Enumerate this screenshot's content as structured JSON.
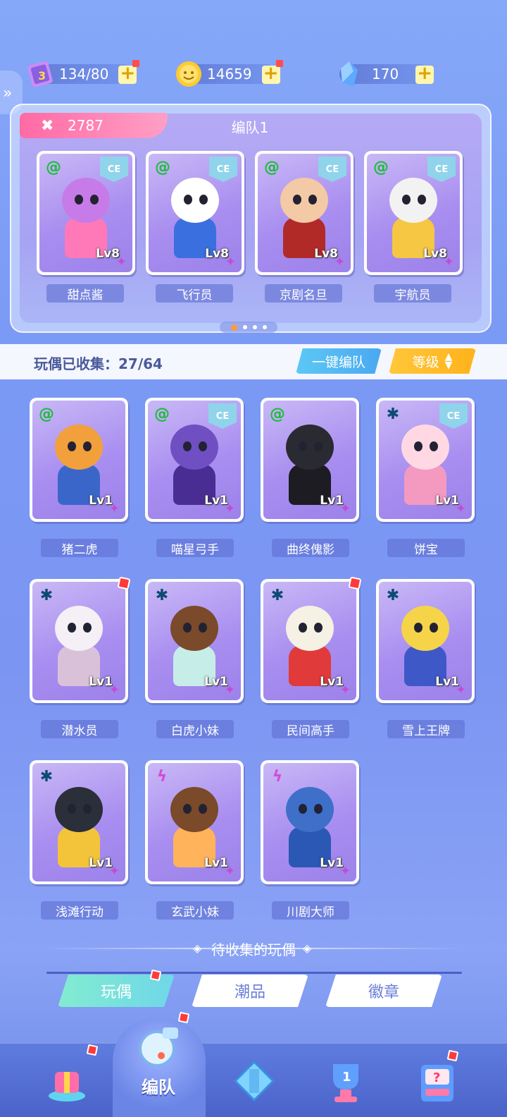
{
  "resources": {
    "stamina": {
      "value": "134/80",
      "icon": "ticket-icon"
    },
    "coins": {
      "value": "14659",
      "icon": "coin-icon"
    },
    "gems": {
      "value": "170",
      "icon": "crystal-icon"
    }
  },
  "team": {
    "power": "2787",
    "title": "编队1",
    "members": [
      {
        "name": "甜点酱",
        "level": "Lv8",
        "type": "spiral",
        "ce": "CE",
        "head": "#c77be8",
        "body": "#ff79b9"
      },
      {
        "name": "飞行员",
        "level": "Lv8",
        "type": "spiral",
        "ce": "CE",
        "head": "#ffffff",
        "body": "#3a6fe0"
      },
      {
        "name": "京剧名旦",
        "level": "Lv8",
        "type": "spiral",
        "ce": "CE",
        "head": "#f4c9a5",
        "body": "#b22a28"
      },
      {
        "name": "宇航员",
        "level": "Lv8",
        "type": "spiral",
        "ce": "CE",
        "head": "#f2f2f2",
        "body": "#f5c742"
      }
    ]
  },
  "collection": {
    "label": "玩偶已收集：27/64",
    "one_click_team": "一键编队",
    "sort_label": "等级"
  },
  "dolls": [
    {
      "name": "猪二虎",
      "level": "Lv1",
      "type": "spiral",
      "ce": "",
      "head": "#f2a03c",
      "body": "#3a66c9",
      "new": false
    },
    {
      "name": "喵星弓手",
      "level": "Lv1",
      "type": "spiral",
      "ce": "CE",
      "head": "#6f4fc2",
      "body": "#4a2d92",
      "new": false
    },
    {
      "name": "曲终傀影",
      "level": "Lv1",
      "type": "spiral",
      "ce": "",
      "head": "#2a2a33",
      "body": "#1c1c22",
      "new": false
    },
    {
      "name": "饼宝",
      "level": "Lv1",
      "type": "star",
      "ce": "CE",
      "head": "#ffd8e4",
      "body": "#f49ac0",
      "new": false
    },
    {
      "name": "潜水员",
      "level": "Lv1",
      "type": "star",
      "ce": "",
      "head": "#f4f0f5",
      "body": "#d9c2d9",
      "new": true
    },
    {
      "name": "白虎小妹",
      "level": "Lv1",
      "type": "star",
      "ce": "",
      "head": "#7a4a2a",
      "body": "#c7ede8",
      "new": false
    },
    {
      "name": "民间高手",
      "level": "Lv1",
      "type": "star",
      "ce": "",
      "head": "#f5f1e4",
      "body": "#e03a3a",
      "new": true
    },
    {
      "name": "雪上王牌",
      "level": "Lv1",
      "type": "star",
      "ce": "",
      "head": "#f5d44a",
      "body": "#3f58c7",
      "new": false
    },
    {
      "name": "浅滩行动",
      "level": "Lv1",
      "type": "star",
      "ce": "",
      "head": "#2a2f3a",
      "body": "#f3c43a",
      "new": false
    },
    {
      "name": "玄武小妹",
      "level": "Lv1",
      "type": "bolt",
      "ce": "",
      "head": "#7a4a2a",
      "body": "#ffb35a",
      "new": false
    },
    {
      "name": "川剧大师",
      "level": "Lv1",
      "type": "bolt",
      "ce": "",
      "head": "#3e6fc9",
      "body": "#2c58b5",
      "new": false
    }
  ],
  "pending": {
    "title": "待收集的玩偶"
  },
  "tabs": [
    {
      "label": "玩偶",
      "active": true
    },
    {
      "label": "潮品",
      "active": false
    },
    {
      "label": "徽章",
      "active": false
    }
  ],
  "nav": {
    "items": [
      {
        "icon": "gift-icon",
        "label": ""
      },
      {
        "icon": "whistle-icon",
        "label": "编队"
      },
      {
        "icon": "gamepad-icon",
        "label": ""
      },
      {
        "icon": "trophy-icon",
        "label": ""
      },
      {
        "icon": "mystery-box-icon",
        "label": ""
      }
    ]
  },
  "colors": {
    "accent_pink": "#ff6aa4",
    "accent_blue": "#4aa8f0",
    "accent_yellow": "#ffb21a",
    "accent_teal": "#6fd7e8"
  }
}
